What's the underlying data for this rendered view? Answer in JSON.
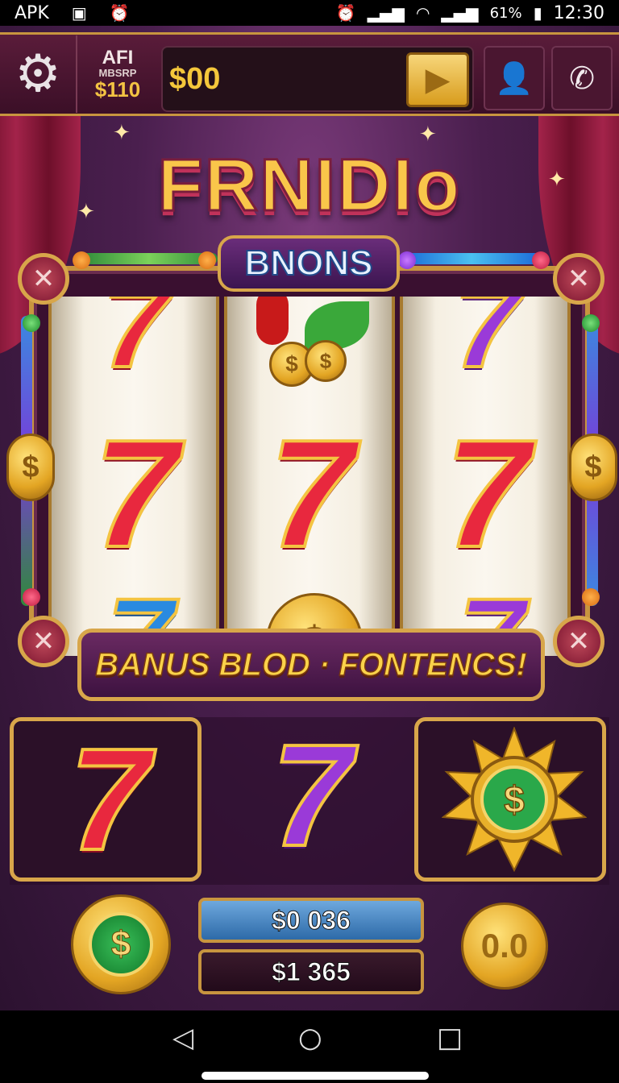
{
  "status_bar": {
    "left_text": "APK",
    "time": "12:30",
    "battery": "61%",
    "icons": [
      "image-icon",
      "alarm-icon",
      "signal-icon",
      "wifi-icon",
      "battery-icon"
    ]
  },
  "top_bar": {
    "account_line1": "AFI",
    "account_line2": "MBSRP",
    "account_line3": "$110",
    "balance": "$00",
    "play_icon": "play-icon",
    "profile_icon": "profile-icon",
    "phone_icon": "phone-icon",
    "settings_icon": "gear-icon"
  },
  "title": "FRNIDIo",
  "bonus_label": "BNONS",
  "reels": [
    [
      "7",
      "7",
      "7"
    ],
    [
      "cherry-coins",
      "7",
      "coin"
    ],
    [
      "7",
      "7",
      "7"
    ]
  ],
  "win_banner": "BANUS BLOD · FONTENCS!",
  "lower_symbols": [
    "7",
    "7",
    "sun-coin"
  ],
  "amounts": {
    "top": "$0 036",
    "bottom": "$1 365"
  },
  "controls": {
    "left_coin_symbol": "$",
    "right_button_label": "0.0",
    "left_coin_icon": "coin-icon",
    "right_button_icon": "pause-icon"
  },
  "nav": {
    "back_icon": "back-icon",
    "home_icon": "home-icon",
    "recent_icon": "recent-icon"
  },
  "symbols": {
    "seven": "7",
    "dollar": "$",
    "close": "✕"
  }
}
